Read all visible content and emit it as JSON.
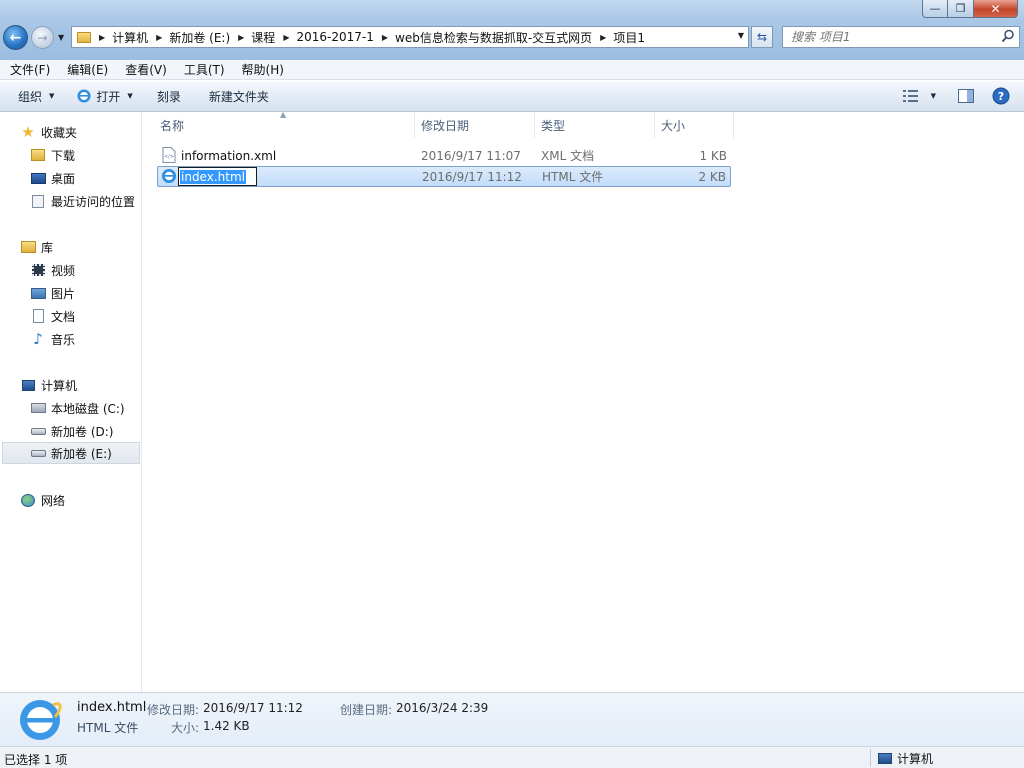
{
  "window": {
    "minimize": "—",
    "maximize": "❐",
    "close": "✕"
  },
  "address": {
    "crumbs": [
      "计算机",
      "新加卷 (E:)",
      "课程",
      "2016-2017-1",
      "web信息检索与数据抓取-交互式网页",
      "项目1"
    ]
  },
  "search": {
    "placeholder": "搜索 项目1"
  },
  "menu": [
    "文件(F)",
    "编辑(E)",
    "查看(V)",
    "工具(T)",
    "帮助(H)"
  ],
  "toolbar": {
    "organize": "组织",
    "open": "打开",
    "burn": "刻录",
    "new_folder": "新建文件夹"
  },
  "nav": {
    "favorites": "收藏夹",
    "downloads": "下载",
    "desktop": "桌面",
    "recent": "最近访问的位置",
    "libraries": "库",
    "videos": "视频",
    "pictures": "图片",
    "documents": "文档",
    "music": "音乐",
    "computer": "计算机",
    "drive_c": "本地磁盘 (C:)",
    "drive_d": "新加卷 (D:)",
    "drive_e": "新加卷 (E:)",
    "network": "网络"
  },
  "columns": {
    "name": "名称",
    "modified": "修改日期",
    "type": "类型",
    "size": "大小"
  },
  "files": [
    {
      "name": "information.xml",
      "modified": "2016/9/17 11:07",
      "type": "XML 文档",
      "size": "1 KB"
    },
    {
      "name": "index.html",
      "modified": "2016/9/17 11:12",
      "type": "HTML 文件",
      "size": "2 KB"
    }
  ],
  "details": {
    "name": "index.html",
    "type": "HTML 文件",
    "modified_label": "修改日期:",
    "modified": "2016/9/17 11:12",
    "created_label": "创建日期:",
    "created": "2016/3/24 2:39",
    "size_label": "大小:",
    "size": "1.42 KB"
  },
  "status": {
    "selection": "已选择 1 项",
    "location": "计算机"
  }
}
